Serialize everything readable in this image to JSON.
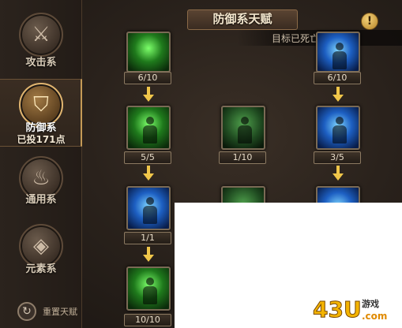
{
  "header": {
    "title": "防御系天赋",
    "status": "目标已死亡",
    "info_icon": "exclamation-icon"
  },
  "sidebar": {
    "categories": [
      {
        "label": "攻击系",
        "icon": "crossed-swords-icon"
      },
      {
        "label": "防御系",
        "sub": "已投171点",
        "icon": "shield-icon",
        "active": true
      },
      {
        "label": "通用系",
        "icon": "flame-icon"
      },
      {
        "label": "元素系",
        "icon": "crystal-icon"
      }
    ],
    "reset_label": "重置天赋"
  },
  "talents": [
    {
      "count": "6/10"
    },
    {
      "count": "6/10"
    },
    {
      "count": "5/5"
    },
    {
      "count": "1/10"
    },
    {
      "count": "3/5"
    },
    {
      "count": "1/1"
    },
    {
      "count": "10/10"
    }
  ],
  "watermark": {
    "text": "43u游戏 .com"
  },
  "colors": {
    "accent": "#f0c64a",
    "active_border": "#c49a56"
  }
}
